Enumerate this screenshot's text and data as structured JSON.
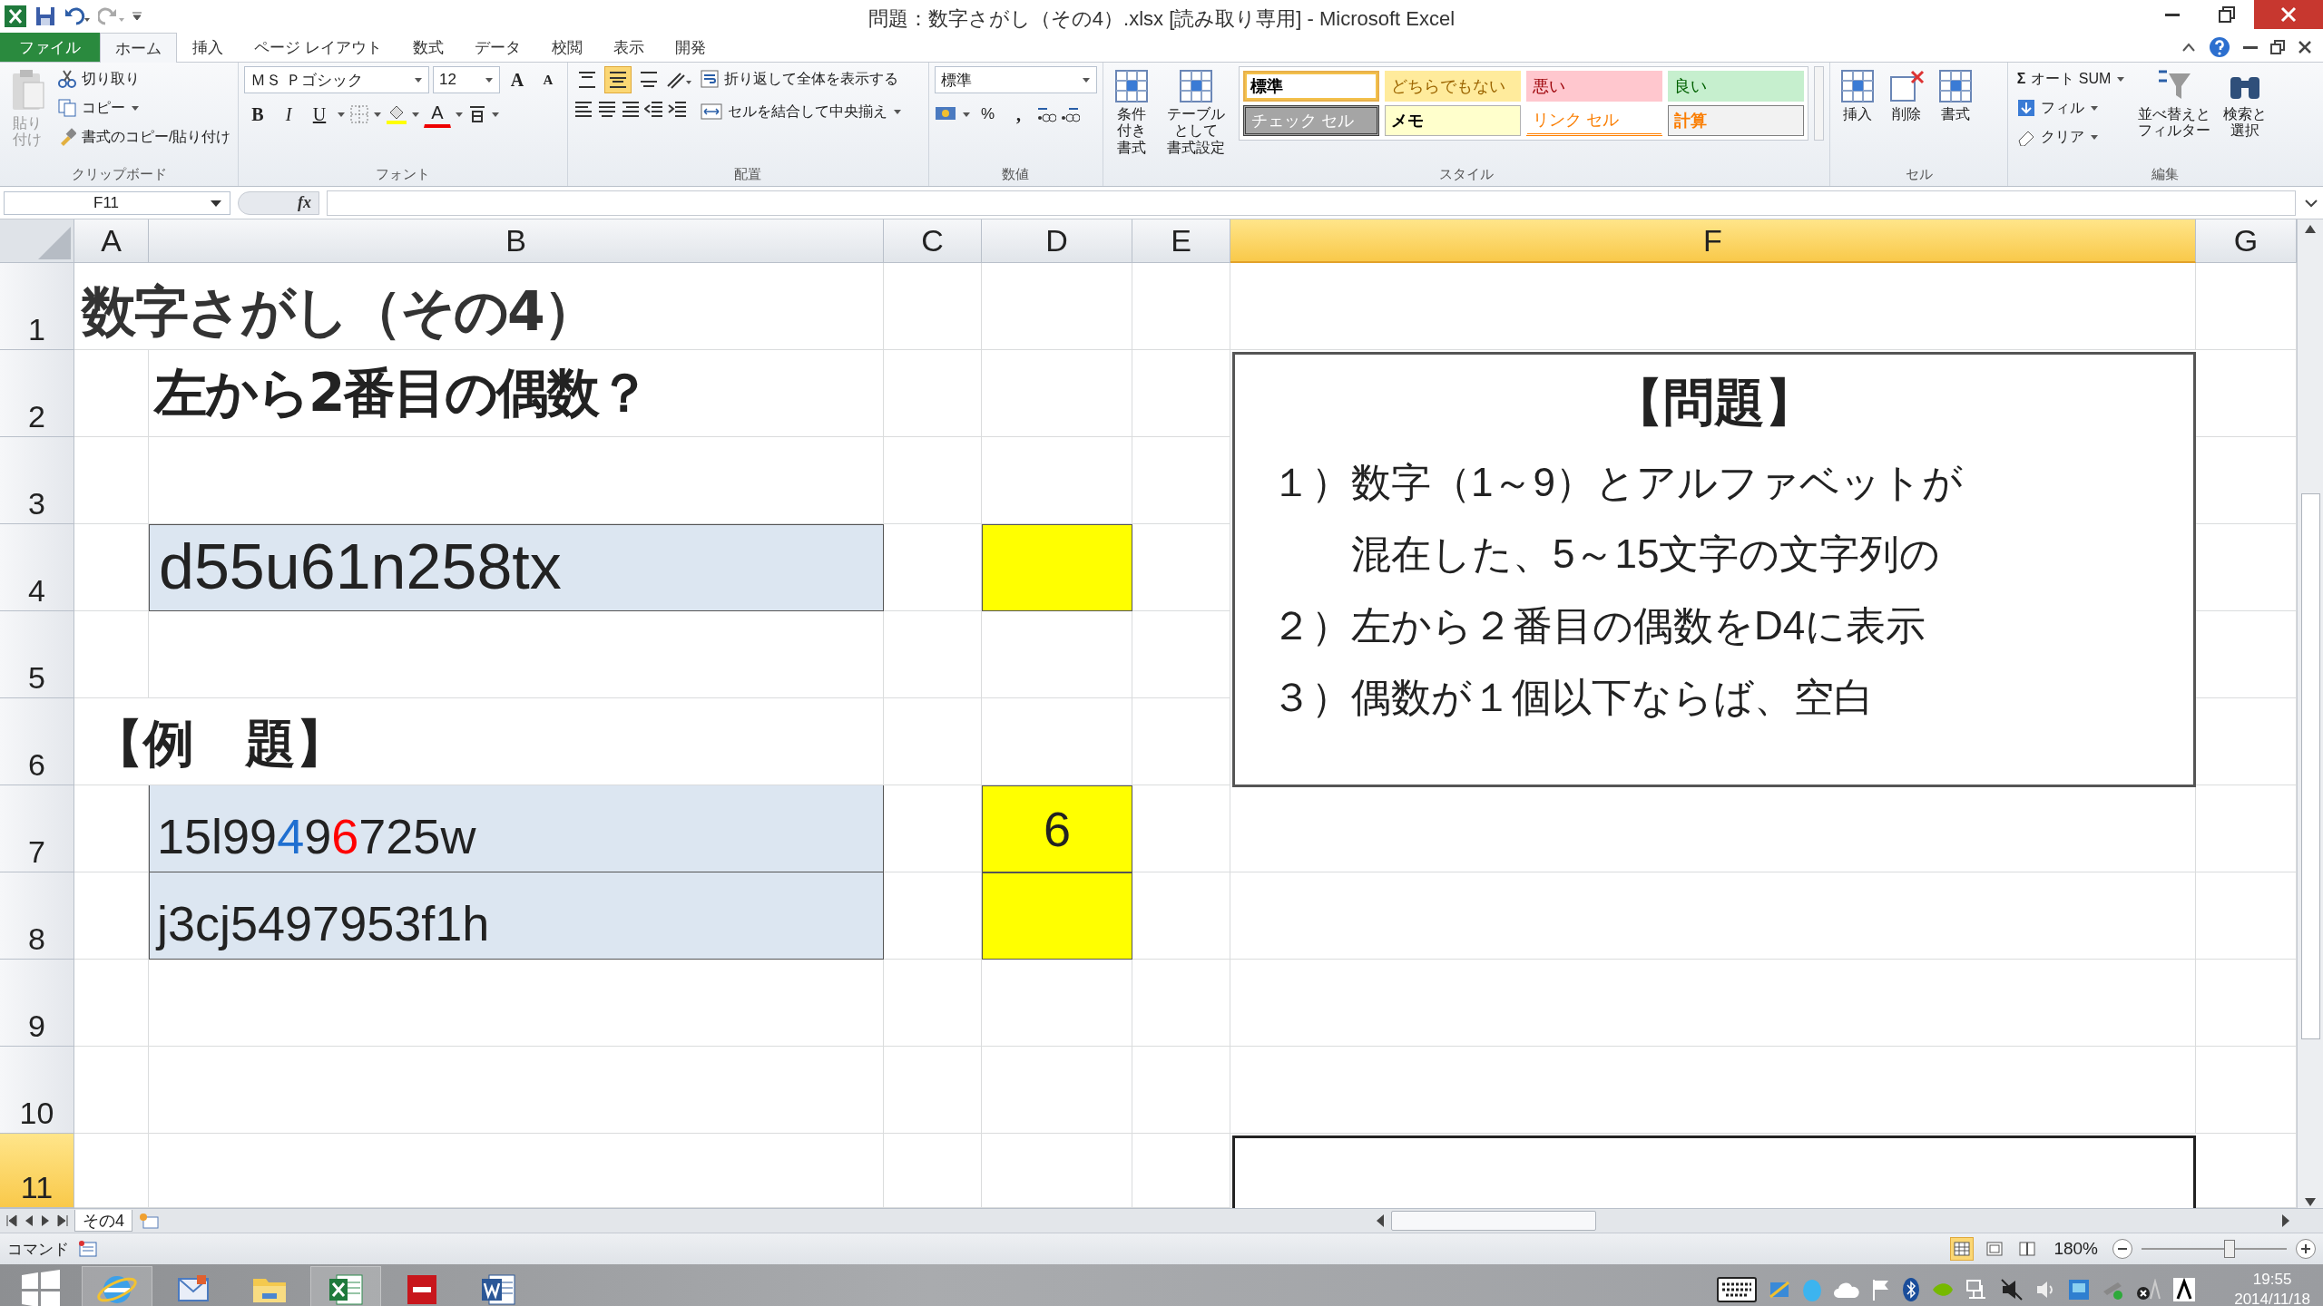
{
  "window": {
    "title": "問題：数字さがし（その4）.xlsx  [読み取り専用] - Microsoft Excel"
  },
  "ribbon_tabs": [
    {
      "label": "ファイル",
      "kind": "file",
      "selected": false
    },
    {
      "label": "ホーム",
      "kind": "tab",
      "selected": true
    },
    {
      "label": "挿入",
      "kind": "tab",
      "selected": false
    },
    {
      "label": "ページ レイアウト",
      "kind": "tab",
      "selected": false
    },
    {
      "label": "数式",
      "kind": "tab",
      "selected": false
    },
    {
      "label": "データ",
      "kind": "tab",
      "selected": false
    },
    {
      "label": "校閲",
      "kind": "tab",
      "selected": false
    },
    {
      "label": "表示",
      "kind": "tab",
      "selected": false
    },
    {
      "label": "開発",
      "kind": "tab",
      "selected": false
    }
  ],
  "ribbon": {
    "clipboard": {
      "label": "クリップボード",
      "paste": "貼り付け",
      "cut": "切り取り",
      "copy": "コピー",
      "format_painter": "書式のコピー/貼り付け"
    },
    "font": {
      "label": "フォント",
      "font_name": "ＭＳ Ｐゴシック",
      "font_size": "12",
      "grow": "A",
      "shrink": "A",
      "bold": "B",
      "italic": "I",
      "underline": "U",
      "font_color": "A"
    },
    "alignment": {
      "label": "配置",
      "vertical": [
        {
          "selected": false
        },
        {
          "selected": true
        },
        {
          "selected": false
        }
      ],
      "wrap_text": "折り返して全体を表示する",
      "merge_center": "セルを結合して中央揃え"
    },
    "number": {
      "label": "数値",
      "format": "標準",
      "percent": "%",
      "comma": ","
    },
    "styles": {
      "label": "スタイル",
      "conditional": [
        "条件付き",
        "書式"
      ],
      "table": [
        "テーブルとして",
        "書式設定"
      ],
      "gallery": [
        {
          "label": "標準",
          "kind": "normal",
          "selected": true
        },
        {
          "label": "どちらでもない",
          "kind": "neutral",
          "selected": false
        },
        {
          "label": "悪い",
          "kind": "bad",
          "selected": false
        },
        {
          "label": "良い",
          "kind": "good",
          "selected": false
        },
        {
          "label": "チェック セル",
          "kind": "check",
          "selected": false
        },
        {
          "label": "メモ",
          "kind": "note",
          "selected": false
        },
        {
          "label": "リンク セル",
          "kind": "link",
          "selected": false
        },
        {
          "label": "計算",
          "kind": "calc",
          "selected": false
        }
      ]
    },
    "cells": {
      "label": "セル",
      "insert": "挿入",
      "delete": "削除",
      "format": "書式"
    },
    "editing": {
      "label": "編集",
      "autosum_icon": "Σ",
      "autosum": "オート SUM",
      "fill": "フィル",
      "clear": "クリア",
      "sort": [
        "並べ替えと",
        "フィルター"
      ],
      "find": [
        "検索と",
        "選択"
      ]
    }
  },
  "formula_bar": {
    "name_box": "F11",
    "fx": "fx"
  },
  "columns": [
    {
      "label": "A",
      "selected": false
    },
    {
      "label": "B",
      "selected": false
    },
    {
      "label": "C",
      "selected": false
    },
    {
      "label": "D",
      "selected": false
    },
    {
      "label": "E",
      "selected": false
    },
    {
      "label": "F",
      "selected": true
    },
    {
      "label": "G",
      "selected": false
    }
  ],
  "rows": [
    {
      "header": "1",
      "selected": false,
      "A": {
        "kind": "title",
        "text": "数字さがし（その4）"
      }
    },
    {
      "header": "2",
      "selected": false,
      "B": {
        "kind": "subtitle",
        "text": "左から2番目の偶数？"
      }
    },
    {
      "header": "3",
      "selected": false
    },
    {
      "header": "4",
      "selected": false,
      "B": {
        "kind": "input",
        "parts": [
          {
            "text": "d55u61n258tx"
          }
        ]
      },
      "D": {
        "kind": "answer"
      }
    },
    {
      "header": "5",
      "selected": false
    },
    {
      "header": "6",
      "selected": false,
      "A": {
        "kind": "heading",
        "text": "【例　題】"
      }
    },
    {
      "header": "7",
      "selected": false,
      "B": {
        "kind": "example",
        "parts": [
          {
            "text": "15l99"
          },
          {
            "text": "4",
            "color": "#1f6fd0"
          },
          {
            "text": "9"
          },
          {
            "text": "6",
            "color": "#ff0000"
          },
          {
            "text": "725w"
          }
        ]
      },
      "D": {
        "kind": "answer",
        "text": "6"
      }
    },
    {
      "header": "8",
      "selected": false,
      "B": {
        "kind": "example",
        "parts": [
          {
            "text": "j3cj5497953f1h"
          }
        ]
      },
      "D": {
        "kind": "answer"
      }
    },
    {
      "header": "9",
      "selected": false
    },
    {
      "header": "10",
      "selected": false
    },
    {
      "header": "11",
      "selected": true
    }
  ],
  "text_box": {
    "title": "【問題】",
    "lines": [
      "１）数字（1～9）とアルファベットが",
      "　　混在した、5～15文字の文字列の",
      "２）左から２番目の偶数をD4に表示",
      "３）偶数が１個以下ならば、空白"
    ]
  },
  "sheet_tabs": [
    {
      "label": "その4",
      "selected": true
    }
  ],
  "status_bar": {
    "mode": "コマンド",
    "zoom": "180%",
    "zoom_level": {
      "level": 0.6
    }
  },
  "taskbar": {
    "time": "19:55",
    "date": "2014/11/18"
  }
}
